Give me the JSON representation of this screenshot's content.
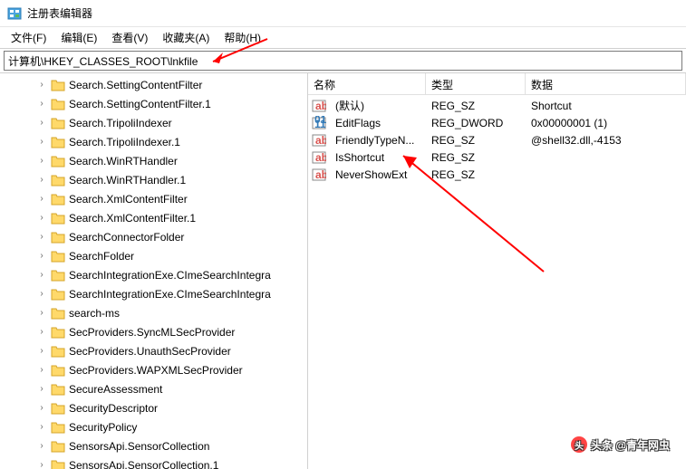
{
  "window": {
    "title": "注册表编辑器"
  },
  "menubar": {
    "file": "文件(F)",
    "edit": "编辑(E)",
    "view": "查看(V)",
    "favorites": "收藏夹(A)",
    "help": "帮助(H)"
  },
  "addressbar": {
    "path": "计算机\\HKEY_CLASSES_ROOT\\lnkfile"
  },
  "tree": {
    "items": [
      {
        "label": "Search.SettingContentFilter"
      },
      {
        "label": "Search.SettingContentFilter.1"
      },
      {
        "label": "Search.TripoliIndexer"
      },
      {
        "label": "Search.TripoliIndexer.1"
      },
      {
        "label": "Search.WinRTHandler"
      },
      {
        "label": "Search.WinRTHandler.1"
      },
      {
        "label": "Search.XmlContentFilter"
      },
      {
        "label": "Search.XmlContentFilter.1"
      },
      {
        "label": "SearchConnectorFolder"
      },
      {
        "label": "SearchFolder"
      },
      {
        "label": "SearchIntegrationExe.CImeSearchIntegra"
      },
      {
        "label": "SearchIntegrationExe.CImeSearchIntegra"
      },
      {
        "label": "search-ms"
      },
      {
        "label": "SecProviders.SyncMLSecProvider"
      },
      {
        "label": "SecProviders.UnauthSecProvider"
      },
      {
        "label": "SecProviders.WAPXMLSecProvider"
      },
      {
        "label": "SecureAssessment"
      },
      {
        "label": "SecurityDescriptor"
      },
      {
        "label": "SecurityPolicy"
      },
      {
        "label": "SensorsApi.SensorCollection"
      },
      {
        "label": "SensorsApi.SensorCollection.1"
      }
    ]
  },
  "values": {
    "columns": {
      "name": "名称",
      "type": "类型",
      "data": "数据"
    },
    "rows": [
      {
        "icon": "string",
        "name": "(默认)",
        "type": "REG_SZ",
        "data": "Shortcut"
      },
      {
        "icon": "binary",
        "name": "EditFlags",
        "type": "REG_DWORD",
        "data": "0x00000001 (1)"
      },
      {
        "icon": "string",
        "name": "FriendlyTypeN...",
        "type": "REG_SZ",
        "data": "@shell32.dll,-4153"
      },
      {
        "icon": "string",
        "name": "IsShortcut",
        "type": "REG_SZ",
        "data": ""
      },
      {
        "icon": "string",
        "name": "NeverShowExt",
        "type": "REG_SZ",
        "data": ""
      }
    ]
  },
  "watermark": {
    "text": "头条 @青年网虫"
  }
}
